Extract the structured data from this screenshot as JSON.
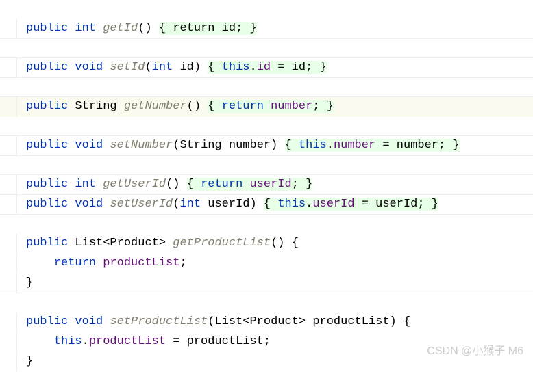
{
  "lines": {
    "l1": {
      "kw1": "public",
      "type": "int",
      "method": "getId",
      "params": "()",
      "body": "{ return id; }"
    },
    "l2": {
      "kw1": "public",
      "kw2": "void",
      "method": "setId",
      "paren_open": "(",
      "ptype": "int",
      "pname": "id",
      "paren_close": ")",
      "brace_open": "{",
      "this": "this",
      "dot": ".",
      "field": "id",
      "eq": " = ",
      "rhs": "id",
      "semi": ";",
      "brace_close": "}"
    },
    "l3": {
      "kw1": "public",
      "type": "String",
      "method": "getNumber",
      "params": "()",
      "brace_open": "{",
      "ret": "return",
      "field": "number",
      "semi": ";",
      "brace_close": "}"
    },
    "l4": {
      "kw1": "public",
      "kw2": "void",
      "method": "setNumber",
      "paren_open": "(",
      "ptype": "String",
      "pname": "number",
      "paren_close": ")",
      "brace_open": "{",
      "this": "this",
      "dot": ".",
      "field": "number",
      "eq": " = ",
      "rhs": "number",
      "semi": ";",
      "brace_close": "}"
    },
    "l5": {
      "kw1": "public",
      "type": "int",
      "method": "getUserId",
      "params": "()",
      "brace_open": "{",
      "ret": "return",
      "field": "userId",
      "semi": ";",
      "brace_close": "}"
    },
    "l6": {
      "kw1": "public",
      "kw2": "void",
      "method": "setUserId",
      "paren_open": "(",
      "ptype": "int",
      "pname": "userId",
      "paren_close": ")",
      "brace_open": "{",
      "this": "this",
      "dot": ".",
      "field": "userId",
      "eq": " = ",
      "rhs": "userId",
      "semi": ";",
      "brace_close": "}"
    },
    "l7": {
      "kw1": "public",
      "type": "List",
      "generic": "<Product>",
      "method": "getProductList",
      "params": "()",
      "brace_open": "{"
    },
    "l8": {
      "indent": "    ",
      "ret": "return",
      "sp": " ",
      "field": "productList",
      "semi": ";"
    },
    "l9": {
      "brace": "}"
    },
    "l10": {
      "kw1": "public",
      "kw2": "void",
      "method": "setProductList",
      "paren_open": "(",
      "ptype": "List",
      "generic": "<Product>",
      "pname": "productList",
      "paren_close": ")",
      "brace_open": "{"
    },
    "l11": {
      "indent": "    ",
      "this": "this",
      "dot": ".",
      "field": "productList",
      "eq": " = ",
      "rhs": "productList",
      "semi": ";"
    },
    "l12": {
      "brace": "}"
    }
  },
  "watermark": "CSDN @小猴子 M6"
}
